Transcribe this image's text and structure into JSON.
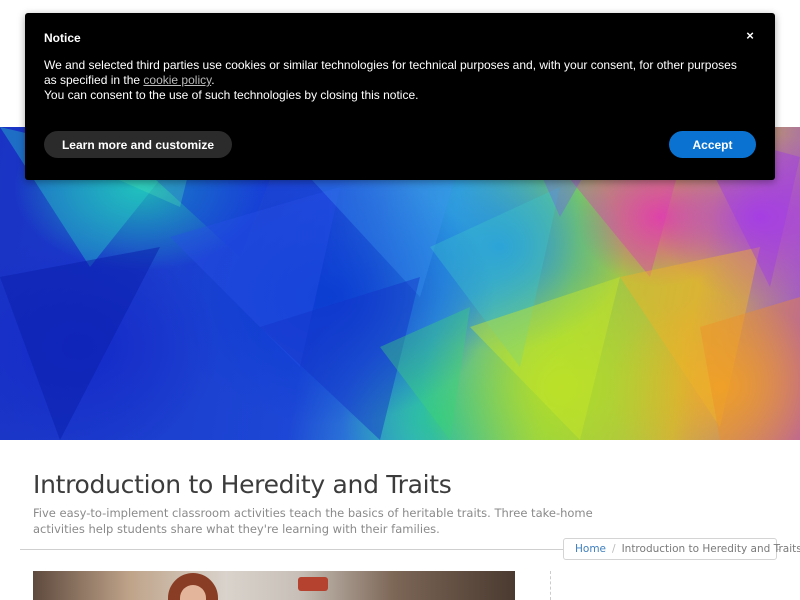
{
  "notice": {
    "title": "Notice",
    "close_glyph": "×",
    "close_icon": "close-icon",
    "body_line1": "We and selected third parties use cookies or similar technologies for technical purposes and, with your consent, for other purposes as specified in the ",
    "policy_link": "cookie policy",
    "body_line1_end": ".",
    "body_line2": "You can consent to the use of such technologies by closing this notice.",
    "customize_label": "Learn more and customize",
    "accept_label": "Accept",
    "accent_color": "#0a73d1"
  },
  "page": {
    "title": "Introduction to Heredity and Traits",
    "description": "Five easy-to-implement classroom activities teach the basics of heritable traits. Three take-home activities help students share what they're learning with their families."
  },
  "breadcrumb": {
    "home": "Home",
    "separator": "/",
    "current": "Introduction to Heredity and Traits",
    "link_color": "#3f7fbf"
  }
}
